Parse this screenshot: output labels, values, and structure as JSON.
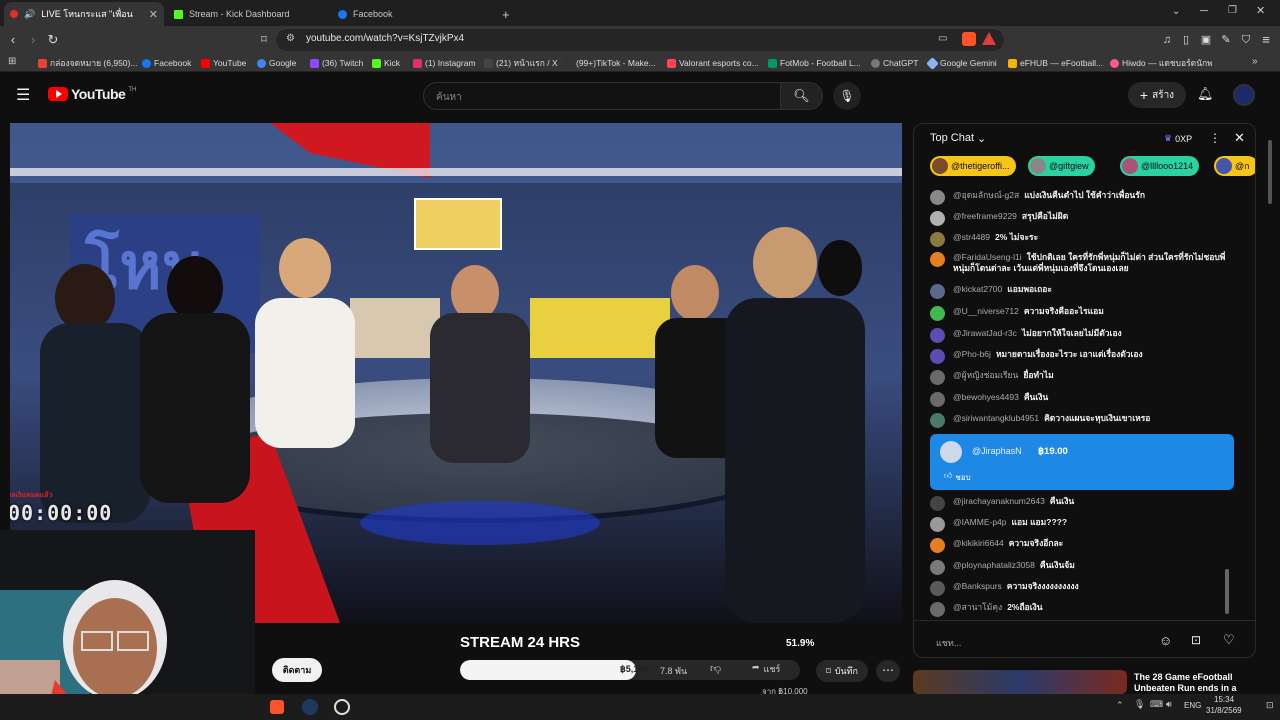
{
  "browser": {
    "tabs": [
      {
        "title": "LIVE โหนกระแส \"เพื่อนรู้จักกัน\"",
        "active": true
      },
      {
        "title": "Stream - Kick Dashboard",
        "active": false
      },
      {
        "title": "Facebook",
        "active": false
      }
    ],
    "new_tab": "+",
    "url": "youtube.com/watch?v=KsjTZvjkPx4",
    "bookmarks": [
      {
        "label": "กล่องจดหมาย (6,950)...",
        "color": "#ea4335"
      },
      {
        "label": "Facebook",
        "color": "#1877f2"
      },
      {
        "label": "YouTube",
        "color": "#ff0000"
      },
      {
        "label": "Google",
        "color": "#4285f4"
      },
      {
        "label": "(36) Twitch",
        "color": "#9146ff"
      },
      {
        "label": "Kick",
        "color": "#53fc18"
      },
      {
        "label": "(1) Instagram",
        "color": "#e1306c"
      },
      {
        "label": "(21) หน้าแรก / X",
        "color": "#444444"
      },
      {
        "label": "(99+)TikTok - Make...",
        "color": "#333333"
      },
      {
        "label": "Valorant esports co...",
        "color": "#ff4655"
      },
      {
        "label": "FotMob - Football L...",
        "color": "#00985f"
      },
      {
        "label": "ChatGPT",
        "color": "#777777"
      },
      {
        "label": "Google Gemini",
        "color": "#8ab4f8"
      },
      {
        "label": "eFHUB — eFootball...",
        "color": "#f5b400"
      },
      {
        "label": "Hiwdo — แดชบอร์ดนักพ...",
        "color": "#ff5a8a"
      }
    ]
  },
  "youtube": {
    "logo": "YouTube",
    "logo_sup": "TH",
    "search_placeholder": "ค้นหา",
    "create_label": "สร้าง"
  },
  "video": {
    "overlay_top": "ผลเงินหมดแล้ว",
    "timer": "00:00:00",
    "stream_title": "STREAM 24 HRS",
    "goal_percent": "51.9%",
    "goal_progress": 0.519,
    "goal_current": "฿5,189",
    "goal_target": "จาก ฿10,000",
    "subscribe_label": "ติดตาม",
    "likes": "7.8 พัน",
    "share_label": "แชร์",
    "save_label": "บันทึก"
  },
  "chat": {
    "mode": "Top Chat",
    "xp": "0XP",
    "chips": [
      {
        "name": "@thetigeroffi...",
        "color": "#f5c518"
      },
      {
        "name": "@giftgiew",
        "color": "#2ad2a0"
      },
      {
        "name": "@llllooo1214",
        "color": "#2ad2a0"
      },
      {
        "name": "@ก",
        "color": "#f5c518"
      }
    ],
    "messages": [
      {
        "author": "@อุดมลักษณ์-g2ส",
        "text": "แบ่งเงินคืนตำไป ใช้คำว่าเพื่อนรัก",
        "color": "#888888"
      },
      {
        "author": "@freeframe9229",
        "text": "สรุปคือไม่ผิด",
        "color": "#b0b0b0"
      },
      {
        "author": "@str4489",
        "text": "2% ไม่จะระ",
        "color": "#8a7a40"
      },
      {
        "author": "@FaridaUseng-l1i",
        "text": "ใช้ปกติเลย ใครที่รักพี่หนุ่มก็ไม่ต่า ส่วนใครที่รักไม่ชอบพี่หนุ่มก็โดนด่าละ เว้นแต่พี่หนุ่มเองที่จึงโดนเองเลย",
        "color": "#e67e22"
      },
      {
        "author": "@kickat2700",
        "text": "แอมพอเถอะ",
        "color": "#5a6a8a"
      },
      {
        "author": "@U__niverse712",
        "text": "ความจริงคืออะไรแอม",
        "color": "#3fb950"
      },
      {
        "author": "@JirawatJad-r3c",
        "text": "ไม่อยากให้ใจเลยไม่มีตัวเอง",
        "color": "#5b4db3"
      },
      {
        "author": "@Pho-b6j",
        "text": "หมายตามเรื่องอะไรวะ เอาแต่เรื่องตัวเอง",
        "color": "#5b4db3"
      },
      {
        "author": "@ผู้หญิงช่อมเรียน",
        "text": "ยื่อทำไม",
        "color": "#6a6a6a"
      },
      {
        "author": "@bewohyes4493",
        "text": "คืนเงิน",
        "color": "#6a6a6a"
      },
      {
        "author": "@siriwantangklub4951",
        "text": "คิดวางแผนจะหุบเงินเขาเหรอ",
        "color": "#4a7a6a"
      }
    ],
    "superchat": {
      "author": "@JiraphasN",
      "amount": "฿19.00",
      "action": "ชอบ"
    },
    "messages2": [
      {
        "author": "@jirachayanaknum2643",
        "text": "คืนเงิน",
        "color": "#444444"
      },
      {
        "author": "@IAMME-p4p",
        "text": "แอม แอม????",
        "color": "#999999"
      },
      {
        "author": "@kikikiri6644",
        "text": "ความจริงอีกละ",
        "color": "#e67e22"
      },
      {
        "author": "@ploynaphataliz3058",
        "text": "คืนเงินจ้ม",
        "color": "#7a7a7a"
      },
      {
        "author": "@Bankspurs",
        "text": "ความจริงงงงงงงงงง",
        "color": "#5a5a5a"
      },
      {
        "author": "@สานาโม้คุง",
        "text": "2%ถือเงิน",
        "color": "#6a6a6a"
      }
    ],
    "input_placeholder": "แชท..."
  },
  "recommend": {
    "title": "The 28 Game eFootball Unbeaten Run ends in a"
  },
  "taskbar": {
    "lang": "ENG",
    "time": "15:34",
    "date": "31/8/2569"
  }
}
